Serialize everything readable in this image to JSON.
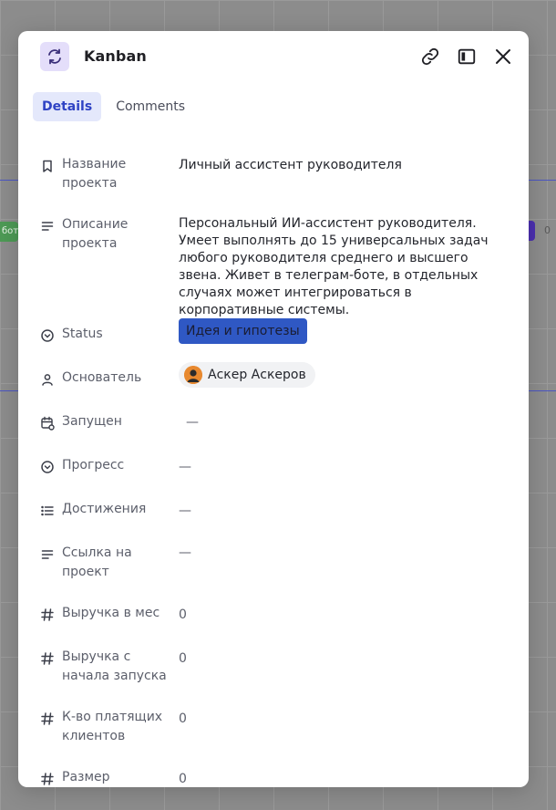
{
  "background": {
    "left_tag": "бот",
    "right_count": "0"
  },
  "modal": {
    "title": "Kanban",
    "tabs": [
      {
        "label": "Details"
      },
      {
        "label": "Comments"
      }
    ],
    "properties": [
      {
        "label": "Название проекта",
        "value": "Личный ассистент руководителя",
        "icon": "bookmark-icon"
      },
      {
        "label": "Описание проекта",
        "value": "Персональный ИИ-ассистент руководителя. Умеет выполнять до 15 универсальных задач любого руководителя среднего и высшего звена. Живет в телеграм-боте, в отдельных случаях может интегрироваться в корпоративные системы.",
        "icon": "text-lines-icon"
      },
      {
        "label": "Status",
        "value": "Идея и гипотезы",
        "icon": "chevron-circle-icon"
      },
      {
        "label": "Основатель",
        "value": "Аскер Аскеров",
        "icon": "person-icon"
      },
      {
        "label": "Запущен",
        "value": "—",
        "icon": "calendar-icon"
      },
      {
        "label": "Прогресс",
        "value": "—",
        "icon": "chevron-circle-icon"
      },
      {
        "label": "Достижения",
        "value": "—",
        "icon": "list-icon"
      },
      {
        "label": "Ссылка на проект",
        "value": "—",
        "icon": "text-lines-icon"
      },
      {
        "label": "Выручка в мес",
        "value": "0",
        "icon": "hash-icon"
      },
      {
        "label": "Выручка с начала запуска",
        "value": "0",
        "icon": "hash-icon"
      },
      {
        "label": "К-во платящих клиентов",
        "value": "0",
        "icon": "hash-icon"
      },
      {
        "label": "Размер",
        "value": "0",
        "icon": "hash-icon"
      }
    ]
  },
  "colors": {
    "accent": "#2f43c4",
    "status_tag": "#2f58c4",
    "app_icon_bg": "#e4defa"
  }
}
